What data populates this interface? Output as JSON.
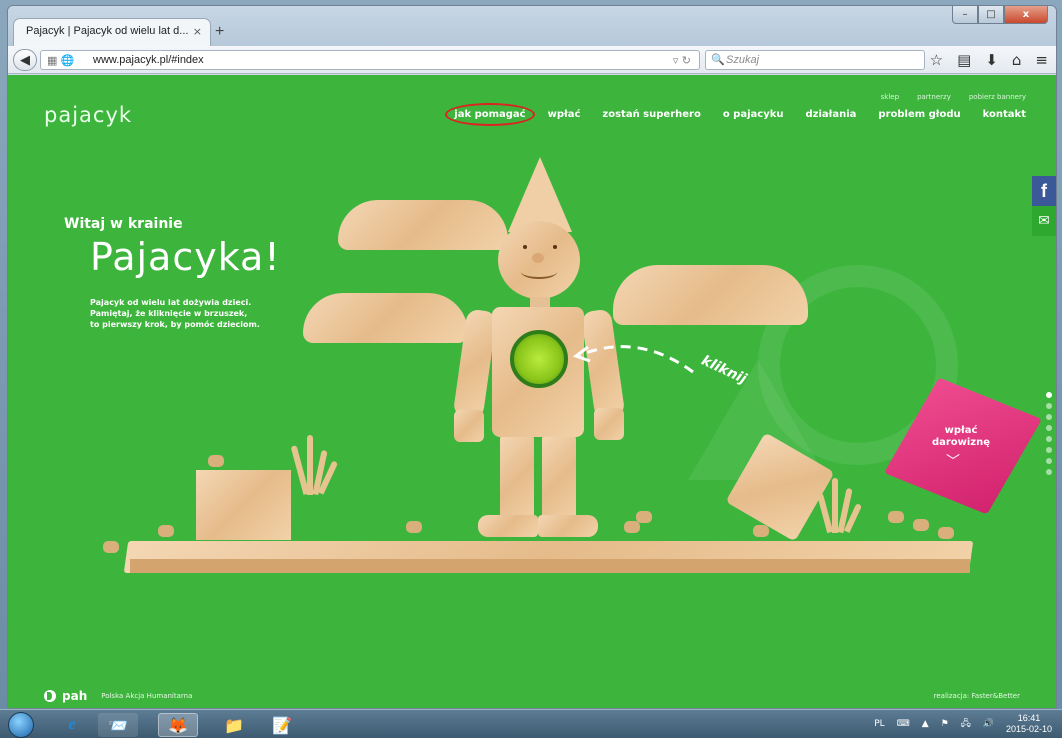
{
  "browser": {
    "tab_title": "Pajacyk | Pajacyk od wielu lat d...",
    "tab_close": "×",
    "new_tab": "+",
    "url": "www.pajacyk.pl/#index",
    "search_placeholder": "Szukaj",
    "controls": {
      "minimize": "–",
      "maximize": "□",
      "close": "x"
    }
  },
  "site": {
    "logo": "pajacyk",
    "top_links": [
      "sklep",
      "partnerzy",
      "pobierz bannery"
    ],
    "nav": [
      "jak pomagać",
      "wpłać",
      "zostań superhero",
      "o pajacyku",
      "działania",
      "problem głodu",
      "kontakt"
    ],
    "highlighted_nav": "jak pomagać",
    "hero": {
      "greeting": "Witaj w krainie",
      "title": "Pajacyka!",
      "intro_lines": [
        "Pajacyk od wielu lat dożywia dzieci.",
        "Pamiętaj, że kliknięcie w brzuszek,",
        "to pierwszy krok, by pomóc dzieciom."
      ]
    },
    "click_hint": "kliknij",
    "donate": {
      "line1": "wpłać",
      "line2": "darowiznę"
    },
    "footer": {
      "brand": "pah",
      "brand_full": "Polska Akcja Humanitarna",
      "credits": "realizacja: Faster&Better"
    },
    "social": {
      "facebook": "f",
      "mail": "✉"
    },
    "pagination_dots": 8,
    "active_dot": 0
  },
  "taskbar": {
    "language": "PL",
    "time": "16:41",
    "date": "2015-02-10"
  },
  "colors": {
    "page_bg": "#3db53d",
    "donate": "#e03a82",
    "facebook": "#3b5998",
    "highlight_circle": "#dd2222"
  }
}
